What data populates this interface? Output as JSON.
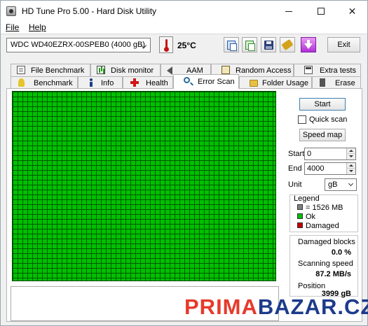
{
  "window": {
    "title": "HD Tune Pro 5.00 - Hard Disk Utility"
  },
  "menu": {
    "file": "File",
    "help": "Help"
  },
  "toolbar": {
    "drive": "WDC WD40EZRX-00SPEB0 (4000 gB)",
    "temperature": "25°C",
    "exit_label": "Exit",
    "icons": [
      "copy-text-icon",
      "copy-screenshot-icon",
      "save-icon",
      "options-icon",
      "download-icon"
    ]
  },
  "tabs": {
    "row1": [
      {
        "label": "File Benchmark",
        "icon": "file-benchmark-icon"
      },
      {
        "label": "Disk monitor",
        "icon": "disk-monitor-icon"
      },
      {
        "label": "AAM",
        "icon": "speaker-icon"
      },
      {
        "label": "Random Access",
        "icon": "random-access-icon"
      },
      {
        "label": "Extra tests",
        "icon": "extra-tests-icon"
      }
    ],
    "row2": [
      {
        "label": "Benchmark",
        "icon": "benchmark-icon"
      },
      {
        "label": "Info",
        "icon": "info-icon"
      },
      {
        "label": "Health",
        "icon": "health-cross-icon"
      },
      {
        "label": "Error Scan",
        "icon": "magnifier-icon",
        "active": true
      },
      {
        "label": "Folder Usage",
        "icon": "folder-icon"
      },
      {
        "label": "Erase",
        "icon": "erase-icon"
      }
    ]
  },
  "scan": {
    "start_label": "Start",
    "quick_scan_label": "Quick scan",
    "quick_scan_checked": false,
    "speed_map_label": "Speed map",
    "start_field_label": "Start",
    "start_value": "0",
    "end_field_label": "End",
    "end_value": "4000",
    "unit_label": "Unit",
    "unit_value": "gB",
    "colors": {
      "ok": "#00c000",
      "damaged": "#c00000",
      "block": "#808080"
    }
  },
  "legend": {
    "title": "Legend",
    "block": "= 1526 MB",
    "ok": "Ok",
    "damaged": "Damaged"
  },
  "stats": {
    "damaged_label": "Damaged blocks",
    "damaged_value": "0.0 %",
    "speed_label": "Scanning speed",
    "speed_value": "87.2 MB/s",
    "position_label": "Position",
    "position_value": "3999 gB"
  },
  "watermark": {
    "part1": "PRIMA",
    "part2": "BAZAR.CZ"
  }
}
